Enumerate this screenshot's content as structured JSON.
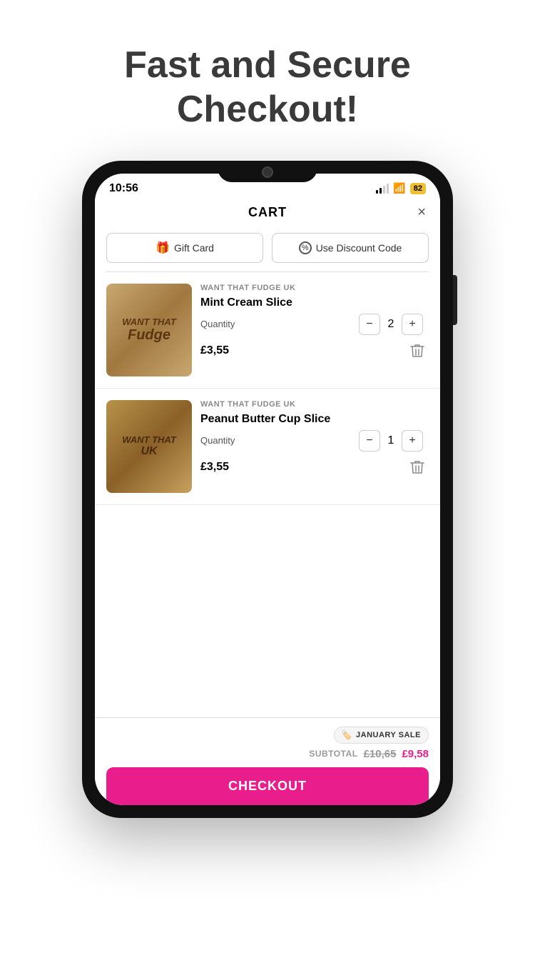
{
  "page": {
    "header": "Fast and Secure Checkout!"
  },
  "status_bar": {
    "time": "10:56",
    "battery": "82"
  },
  "cart": {
    "title": "CART",
    "close_label": "×",
    "action_buttons": [
      {
        "id": "gift-card",
        "icon": "🎁",
        "label": "Gift Card"
      },
      {
        "id": "discount-code",
        "icon": "%",
        "label": "Use Discount Code"
      }
    ],
    "items": [
      {
        "id": "item-1",
        "brand": "WANT THAT FUDGE UK",
        "name": "Mint Cream Slice",
        "quantity": 2,
        "price": "£3,55",
        "image_text": "WANT THAT\nFudge"
      },
      {
        "id": "item-2",
        "brand": "WANT THAT FUDGE UK",
        "name": "Peanut Butter Cup Slice",
        "quantity": 1,
        "price": "£3,55",
        "image_text": "WANT THAT\nUK"
      }
    ],
    "footer": {
      "sale_badge": "JANUARY SALE",
      "subtotal_label": "SUBTOTAL",
      "subtotal_original": "£10,65",
      "subtotal_discounted": "£9,58",
      "checkout_label": "CHECKOUT"
    }
  }
}
